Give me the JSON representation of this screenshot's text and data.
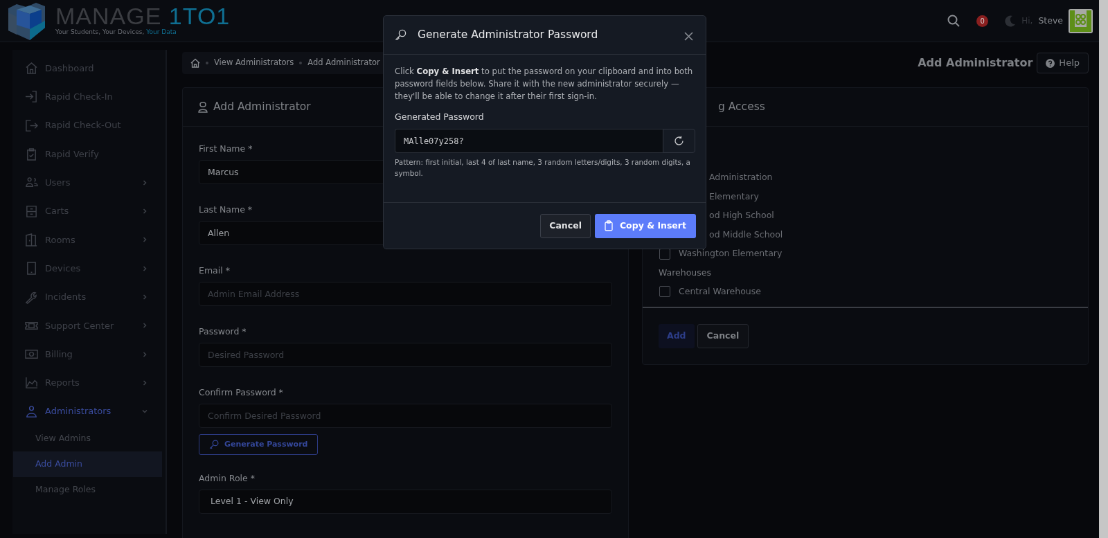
{
  "header": {
    "logo_text": "MANAGE",
    "logo_accent": "1TO1",
    "tagline": "Your Students, Your Devices,",
    "tagline_accent": "Your Data",
    "notification_count": "0",
    "greeting": "Hi,",
    "user_name": "Steve"
  },
  "sidebar": {
    "items": [
      {
        "label": "Dashboard",
        "kind": "link",
        "selected": false
      },
      {
        "label": "Rapid Check-In",
        "kind": "link",
        "selected": false
      },
      {
        "label": "Rapid Check-Out",
        "kind": "link",
        "selected": false
      },
      {
        "label": "Rapid Verify",
        "kind": "link",
        "selected": false
      },
      {
        "label": "Users",
        "kind": "menu",
        "selected": false,
        "expanded": false
      },
      {
        "label": "Carts",
        "kind": "menu",
        "selected": false,
        "expanded": false
      },
      {
        "label": "Rooms",
        "kind": "menu",
        "selected": false,
        "expanded": false
      },
      {
        "label": "Devices",
        "kind": "menu",
        "selected": false,
        "expanded": false
      },
      {
        "label": "Incidents",
        "kind": "menu",
        "selected": false,
        "expanded": false
      },
      {
        "label": "Support Center",
        "kind": "menu",
        "selected": false,
        "expanded": false
      },
      {
        "label": "Billing",
        "kind": "menu",
        "selected": false,
        "expanded": false
      },
      {
        "label": "Reports",
        "kind": "menu",
        "selected": false,
        "expanded": false
      },
      {
        "label": "Administrators",
        "kind": "menu",
        "selected": true,
        "expanded": true,
        "children": [
          {
            "label": "View Admins",
            "selected": false
          },
          {
            "label": "Add Admin",
            "selected": true
          },
          {
            "label": "Manage Roles",
            "selected": false
          }
        ]
      }
    ]
  },
  "breadcrumb": [
    "View Administrators",
    "Add Administrator"
  ],
  "page_title": "Add Administrator",
  "help_button": "Help",
  "form": {
    "title": "Add Administrator",
    "fields": [
      {
        "kind": "input",
        "label": "First Name *",
        "value": "Marcus"
      },
      {
        "kind": "input",
        "label": "Last Name *",
        "value": "Allen"
      },
      {
        "kind": "input",
        "label": "Email *",
        "placeholder": "Admin Email Address"
      },
      {
        "kind": "input",
        "label": "Password *",
        "placeholder": "Desired Password"
      },
      {
        "kind": "input",
        "label": "Confirm Password *",
        "placeholder": "Confirm Desired Password"
      },
      {
        "kind": "button",
        "label": "Generate Password"
      },
      {
        "kind": "select",
        "label": "Admin Role *",
        "value": "Level 1 - View Only"
      }
    ]
  },
  "access_card": {
    "title": "g Access",
    "rows": [
      {
        "kind": "clipped",
        "label": "Administration"
      },
      {
        "kind": "clipped",
        "label": "Elementary"
      },
      {
        "kind": "clipped",
        "label": "od High School"
      },
      {
        "kind": "clipped",
        "label": "od Middle School"
      },
      {
        "kind": "checkbox",
        "label": "Washington Elementary",
        "checked": false
      },
      {
        "kind": "group",
        "label": "Warehouses"
      },
      {
        "kind": "checkbox",
        "label": "Central Warehouse",
        "checked": false
      }
    ],
    "add_button": "Add",
    "cancel_button": "Cancel"
  },
  "modal": {
    "title": "Generate Administrator Password",
    "text": "Click **Copy & Insert** to put the password on your clipboard and into both password fields below. Share it with the new administrator securely — they'll be able to change it after their first sign-in.",
    "field_label": "Generated Password",
    "password": "MAlle07y258?",
    "hint": "Pattern: first initial, last 4 of last name, 3 random letters/digits, 3 random digits, a symbol.",
    "cancel_button": "Cancel",
    "confirm_button": "Copy & Insert"
  }
}
